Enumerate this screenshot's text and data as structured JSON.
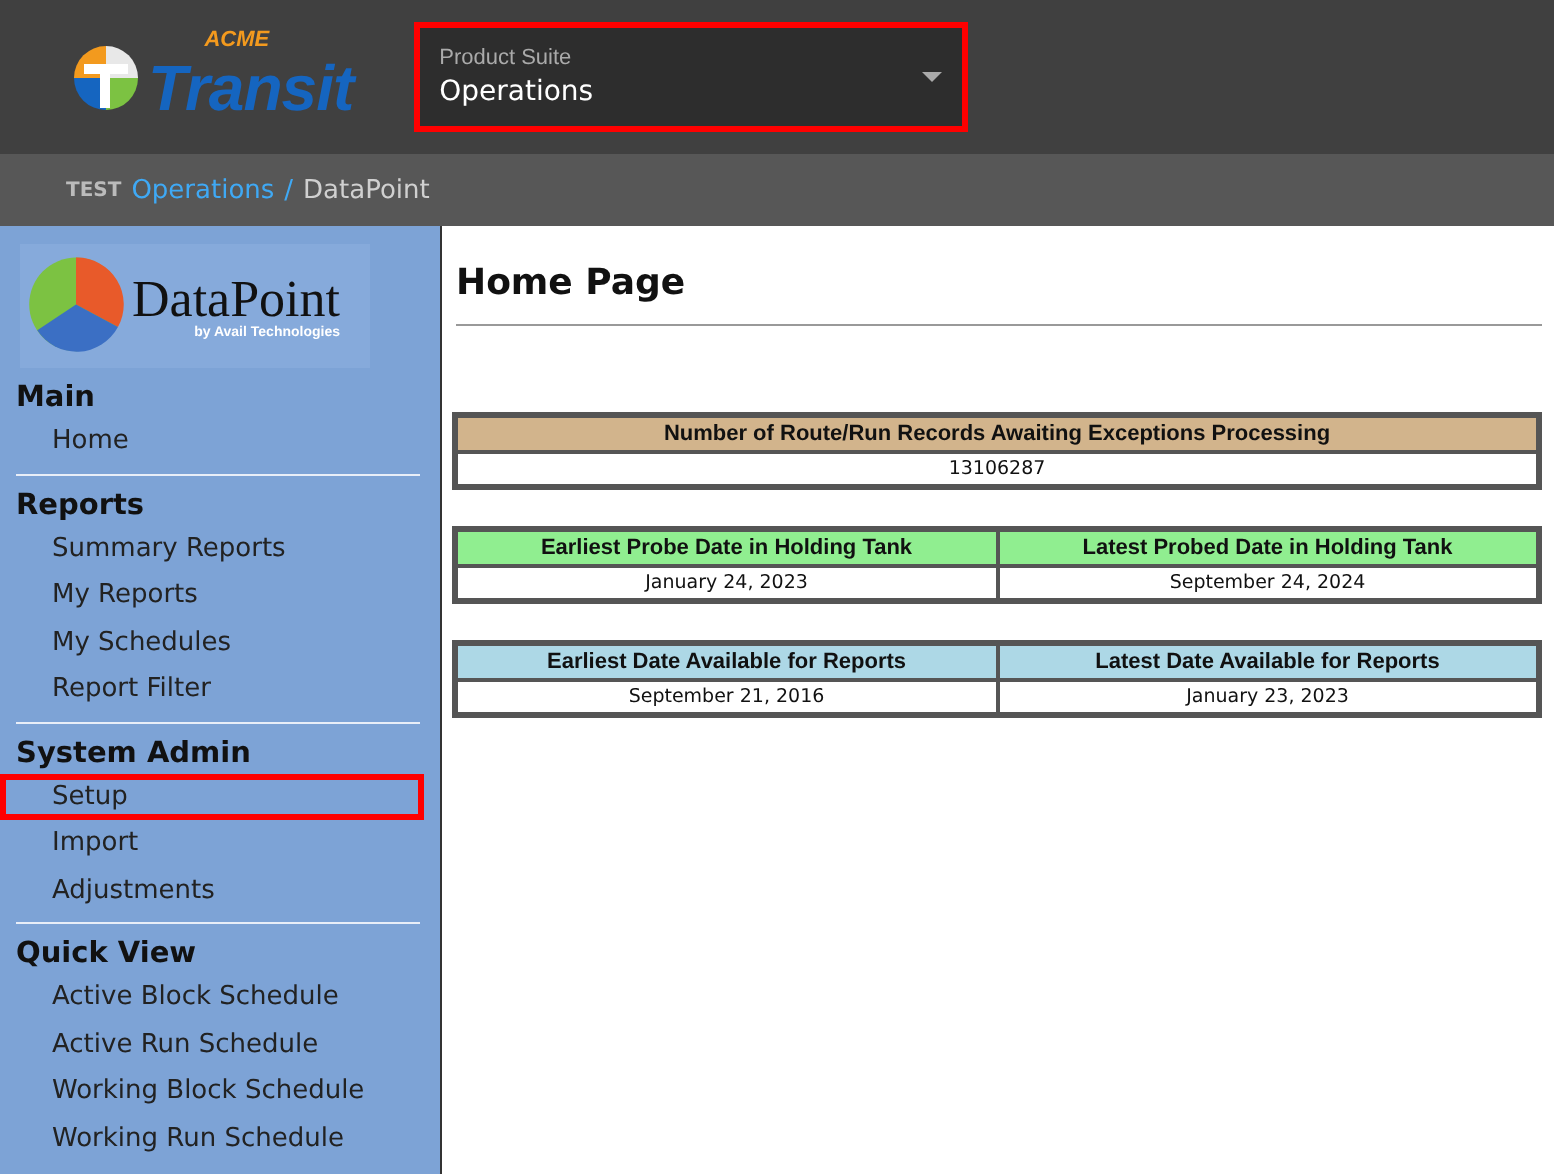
{
  "header": {
    "logo": {
      "small_text": "ACME",
      "large_text": "Transit"
    },
    "product_suite": {
      "label": "Product Suite",
      "value": "Operations",
      "highlighted": true
    }
  },
  "breadcrumb": {
    "prefix": "TEST",
    "items": [
      {
        "label": "Operations",
        "link": true
      },
      {
        "label": "DataPoint",
        "link": false
      }
    ],
    "separator": "/"
  },
  "sidebar": {
    "logo": {
      "name": "DataPoint",
      "byline": "by Avail Technologies"
    },
    "sections": [
      {
        "title": "Main",
        "items": [
          {
            "label": "Home",
            "highlighted": false
          }
        ]
      },
      {
        "title": "Reports",
        "items": [
          {
            "label": "Summary Reports",
            "highlighted": false
          },
          {
            "label": "My Reports",
            "highlighted": false
          },
          {
            "label": "My Schedules",
            "highlighted": false
          },
          {
            "label": "Report Filter",
            "highlighted": false
          }
        ]
      },
      {
        "title": "System Admin",
        "items": [
          {
            "label": "Setup",
            "highlighted": true
          },
          {
            "label": "Import",
            "highlighted": false
          },
          {
            "label": "Adjustments",
            "highlighted": false
          }
        ]
      },
      {
        "title": "Quick View",
        "items": [
          {
            "label": "Active Block Schedule",
            "highlighted": false
          },
          {
            "label": "Active Run Schedule",
            "highlighted": false
          },
          {
            "label": "Working Block Schedule",
            "highlighted": false
          },
          {
            "label": "Working Run Schedule",
            "highlighted": false
          }
        ]
      }
    ]
  },
  "main": {
    "title": "Home Page",
    "tables": [
      {
        "color": "#d2b48c",
        "columns": [
          {
            "heading": "Number of Route/Run Records Awaiting Exceptions Processing",
            "value": "13106287"
          }
        ]
      },
      {
        "color": "#90ee90",
        "columns": [
          {
            "heading": "Earliest Probe Date in Holding Tank",
            "value": "January 24, 2023"
          },
          {
            "heading": "Latest Probed Date in Holding Tank",
            "value": "September 24, 2024"
          }
        ]
      },
      {
        "color": "#add8e6",
        "columns": [
          {
            "heading": "Earliest Date Available for Reports",
            "value": "September 21, 2016"
          },
          {
            "heading": "Latest Date Available for Reports",
            "value": "January 23, 2023"
          }
        ]
      }
    ]
  }
}
